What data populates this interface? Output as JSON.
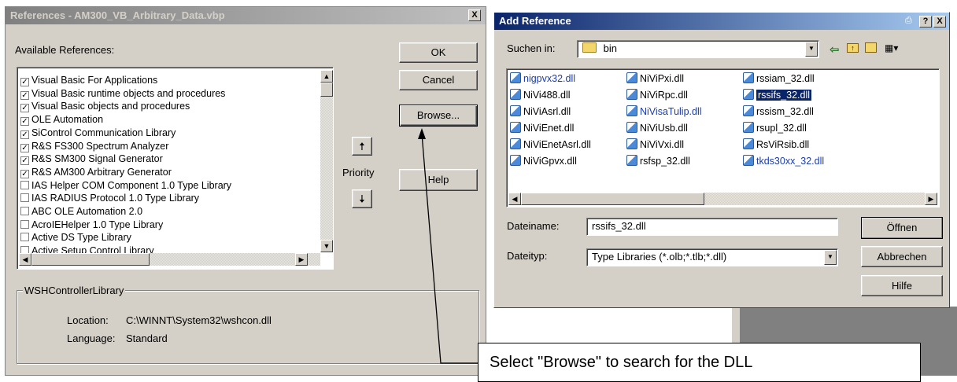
{
  "references_dialog": {
    "title": "References - AM300_VB_Arbitrary_Data.vbp",
    "close_glyph": "X",
    "available_label": "Available References:",
    "items": [
      {
        "label": "Visual Basic For Applications",
        "checked": true
      },
      {
        "label": "Visual Basic runtime objects and procedures",
        "checked": true
      },
      {
        "label": "Visual Basic objects and procedures",
        "checked": true
      },
      {
        "label": "OLE Automation",
        "checked": true
      },
      {
        "label": "SiControl Communication Library",
        "checked": true
      },
      {
        "label": "R&S FS300 Spectrum Analyzer",
        "checked": true
      },
      {
        "label": "R&S SM300 Signal Generator",
        "checked": true
      },
      {
        "label": "R&S AM300 Arbitrary Generator",
        "checked": true
      },
      {
        "label": "IAS Helper COM Component 1.0 Type Library",
        "checked": false
      },
      {
        "label": "IAS RADIUS Protocol 1.0 Type Library",
        "checked": false
      },
      {
        "label": "ABC OLE Automation 2.0",
        "checked": false
      },
      {
        "label": "AcroIEHelper 1.0 Type Library",
        "checked": false
      },
      {
        "label": "Active DS Type Library",
        "checked": false
      },
      {
        "label": "Active Setup Control Library",
        "checked": false
      }
    ],
    "ok_label": "OK",
    "cancel_label": "Cancel",
    "browse_label": "Browse...",
    "priority_label": "Priority",
    "help_label": "Help",
    "group_title": "WSHControllerLibrary",
    "location_label": "Location:",
    "location_value": "C:\\WINNT\\System32\\wshcon.dll",
    "language_label": "Language:",
    "language_value": "Standard"
  },
  "add_reference_dialog": {
    "title": "Add Reference",
    "title_buttons": [
      "?",
      "X"
    ],
    "look_in_label": "Suchen in:",
    "look_in_value": "bin",
    "files_col1": [
      {
        "name": "nigpvx32.dll",
        "blue": true
      },
      {
        "name": "NiVi488.dll",
        "blue": false
      },
      {
        "name": "NiViAsrl.dll",
        "blue": false
      },
      {
        "name": "NiViEnet.dll",
        "blue": false
      },
      {
        "name": "NiViEnetAsrl.dll",
        "blue": false
      },
      {
        "name": "NiViGpvx.dll",
        "blue": false
      }
    ],
    "files_col2": [
      {
        "name": "NiViPxi.dll",
        "blue": false
      },
      {
        "name": "NiViRpc.dll",
        "blue": false
      },
      {
        "name": "NiVisaTulip.dll",
        "blue": true
      },
      {
        "name": "NiViUsb.dll",
        "blue": false
      },
      {
        "name": "NiViVxi.dll",
        "blue": false
      },
      {
        "name": "rsfsp_32.dll",
        "blue": false
      }
    ],
    "files_col3": [
      {
        "name": "rssiam_32.dll",
        "blue": false
      },
      {
        "name": "rssifs_32.dll",
        "blue": false,
        "selected": true
      },
      {
        "name": "rssism_32.dll",
        "blue": false
      },
      {
        "name": "rsupl_32.dll",
        "blue": false
      },
      {
        "name": "RsViRsib.dll",
        "blue": false
      },
      {
        "name": "tkds30xx_32.dll",
        "blue": true
      }
    ],
    "filename_label": "Dateiname:",
    "filename_value": "rssifs_32.dll",
    "filetype_label": "Dateityp:",
    "filetype_value": "Type Libraries (*.olb;*.tlb;*.dll)",
    "open_label": "Öffnen",
    "cancel_label": "Abbrechen",
    "help_label": "Hilfe"
  },
  "callout": {
    "text": "Select \"Browse\" to search for the DLL"
  },
  "colors": {
    "dialog_face": "#d4d0c8",
    "active_title": "#0a246a",
    "selection": "#0a246a",
    "link_blue": "#1a3cb0"
  }
}
